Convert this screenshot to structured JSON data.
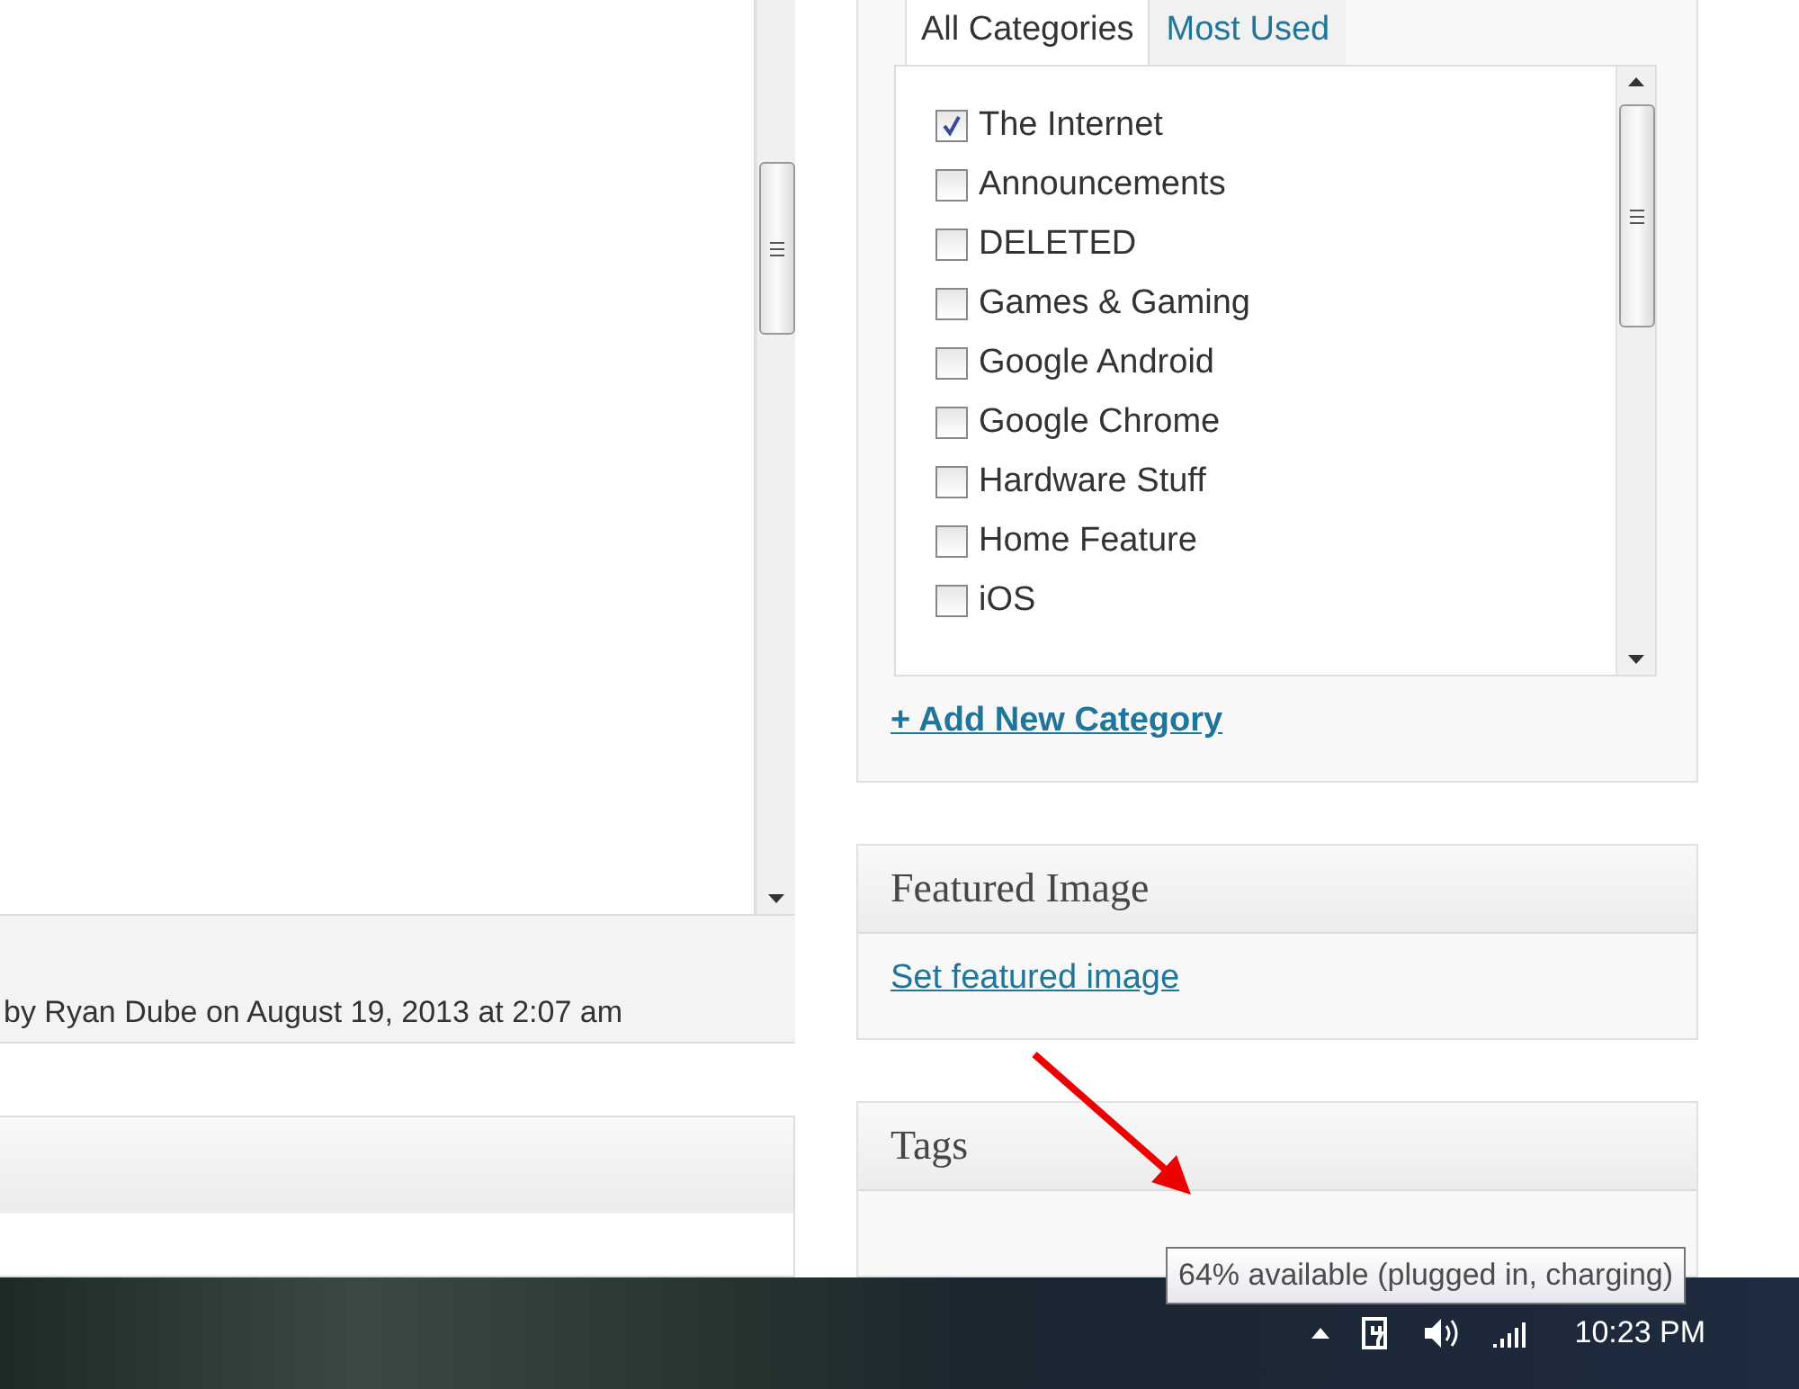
{
  "editor": {
    "byline": "by Ryan Dube on August 19, 2013 at 2:07 am"
  },
  "categories": {
    "tabs": [
      {
        "label": "All Categories",
        "selected": true
      },
      {
        "label": "Most Used",
        "selected": false
      }
    ],
    "items": [
      {
        "label": "The Internet",
        "checked": true
      },
      {
        "label": "Announcements",
        "checked": false
      },
      {
        "label": "DELETED",
        "checked": false
      },
      {
        "label": "Games & Gaming",
        "checked": false
      },
      {
        "label": "Google Android",
        "checked": false
      },
      {
        "label": "Google Chrome",
        "checked": false
      },
      {
        "label": "Hardware Stuff",
        "checked": false
      },
      {
        "label": "Home Feature",
        "checked": false
      },
      {
        "label": "iOS",
        "checked": false
      }
    ],
    "add_link": "+ Add New Category"
  },
  "featured_image": {
    "title": "Featured Image",
    "link": "Set featured image"
  },
  "tags": {
    "title": "Tags"
  },
  "tooltip": "64% available (plugged in, charging)",
  "taskbar": {
    "clock": "10:23 PM"
  }
}
